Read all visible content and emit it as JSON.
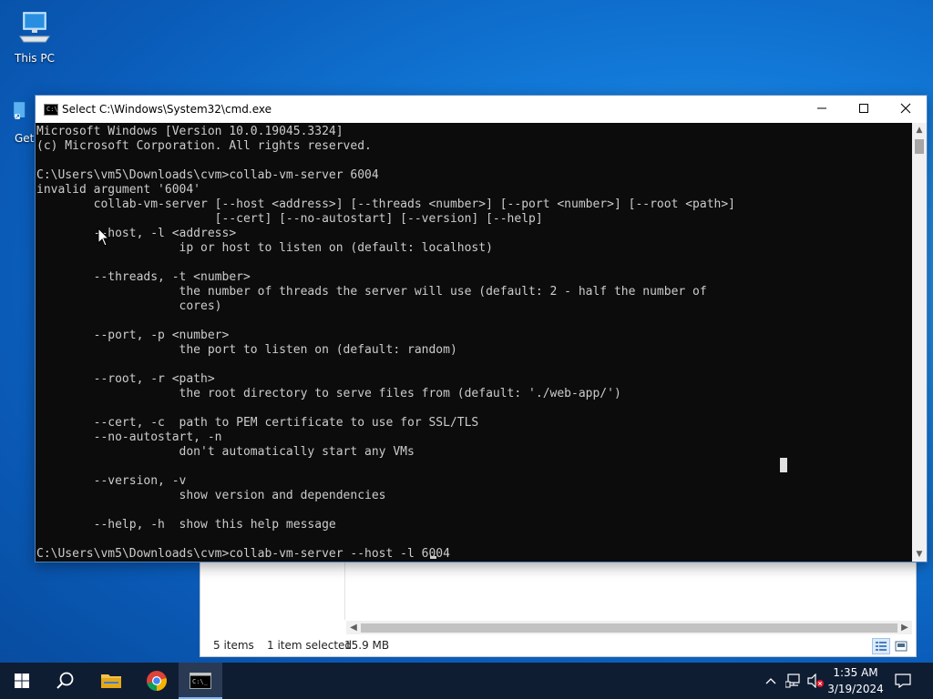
{
  "desktop": {
    "icons": [
      {
        "label": "This PC",
        "icon": "computer-icon"
      },
      {
        "label": "Get",
        "icon": "shortcut-icon"
      }
    ]
  },
  "explorer": {
    "status_items": "5 items",
    "status_selected": "1 item selected",
    "status_size": "15.9 MB"
  },
  "cmd": {
    "title": "Select C:\\Windows\\System32\\cmd.exe",
    "lines": [
      "Microsoft Windows [Version 10.0.19045.3324]",
      "(c) Microsoft Corporation. All rights reserved.",
      "",
      "C:\\Users\\vm5\\Downloads\\cvm>collab-vm-server 6004",
      "invalid argument '6004'",
      "        collab-vm-server [--host <address>] [--threads <number>] [--port <number>] [--root <path>]",
      "                         [--cert] [--no-autostart] [--version] [--help]",
      "        --host, -l <address>",
      "                    ip or host to listen on (default: localhost)",
      "",
      "        --threads, -t <number>",
      "                    the number of threads the server will use (default: 2 - half the number of",
      "                    cores)",
      "",
      "        --port, -p <number>",
      "                    the port to listen on (default: random)",
      "",
      "        --root, -r <path>",
      "                    the root directory to serve files from (default: './web-app/')",
      "",
      "        --cert, -c  path to PEM certificate to use for SSL/TLS",
      "        --no-autostart, -n",
      "                    don't automatically start any VMs",
      "",
      "        --version, -v",
      "                    show version and dependencies",
      "",
      "        --help, -h  show this help message",
      "",
      "C:\\Users\\vm5\\Downloads\\cvm>collab-vm-server --host -l 6004"
    ]
  },
  "taskbar": {
    "apps": [
      {
        "name": "start-button",
        "icon": "windows-logo-icon"
      },
      {
        "name": "search-button",
        "icon": "search-icon"
      },
      {
        "name": "file-explorer",
        "icon": "folder-icon"
      },
      {
        "name": "chrome",
        "icon": "chrome-icon"
      },
      {
        "name": "command-prompt",
        "icon": "cmd-icon",
        "active": true
      }
    ],
    "time": "1:35 AM",
    "date": "3/19/2024"
  },
  "colors": {
    "console_bg": "#0c0c0c",
    "console_fg": "#cccccc",
    "taskbar": "#0f1d33",
    "desktop": "#1279d8"
  }
}
